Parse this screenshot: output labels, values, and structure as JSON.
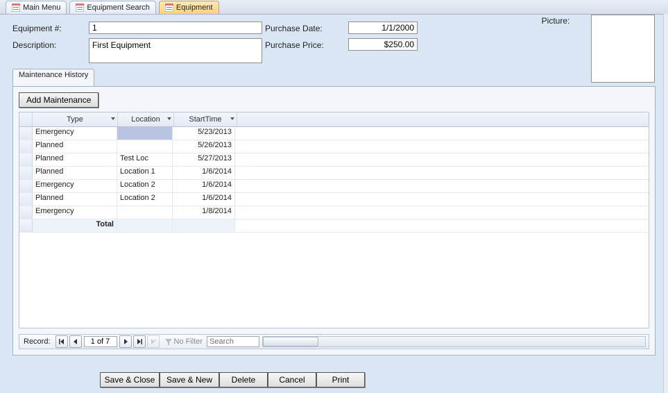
{
  "tabs": [
    {
      "label": "Main Menu",
      "active": false
    },
    {
      "label": "Equipment Search",
      "active": false
    },
    {
      "label": "Equipment",
      "active": true
    }
  ],
  "form": {
    "equipment_number_label": "Equipment #:",
    "equipment_number_value": "1",
    "description_label": "Description:",
    "description_value": "First Equipment",
    "purchase_date_label": "Purchase Date:",
    "purchase_date_value": "1/1/2000",
    "purchase_price_label": "Purchase Price:",
    "purchase_price_value": "$250.00",
    "picture_label": "Picture:"
  },
  "subtab": {
    "label": "Maintenance History",
    "add_button": "Add Maintenance",
    "columns": {
      "type": "Type",
      "location": "Location",
      "starttime": "StartTime"
    },
    "rows": [
      {
        "type": "Emergency",
        "location": "",
        "starttime": "5/23/2013",
        "selected": true
      },
      {
        "type": "Planned",
        "location": "",
        "starttime": "5/26/2013"
      },
      {
        "type": "Planned",
        "location": "Test Loc",
        "starttime": "5/27/2013"
      },
      {
        "type": "Planned",
        "location": "Location 1",
        "starttime": "1/6/2014"
      },
      {
        "type": "Emergency",
        "location": "Location 2",
        "starttime": "1/6/2014"
      },
      {
        "type": "Planned",
        "location": "Location 2",
        "starttime": "1/6/2014"
      },
      {
        "type": "Emergency",
        "location": "",
        "starttime": "1/8/2014"
      }
    ],
    "total_label": "Total"
  },
  "recordnav": {
    "label": "Record:",
    "position": "1 of 7",
    "filter_label": "No Filter",
    "search_placeholder": "Search"
  },
  "buttons": {
    "save_close": "Save & Close",
    "save_new": "Save & New",
    "delete": "Delete",
    "cancel": "Cancel",
    "print": "Print"
  }
}
